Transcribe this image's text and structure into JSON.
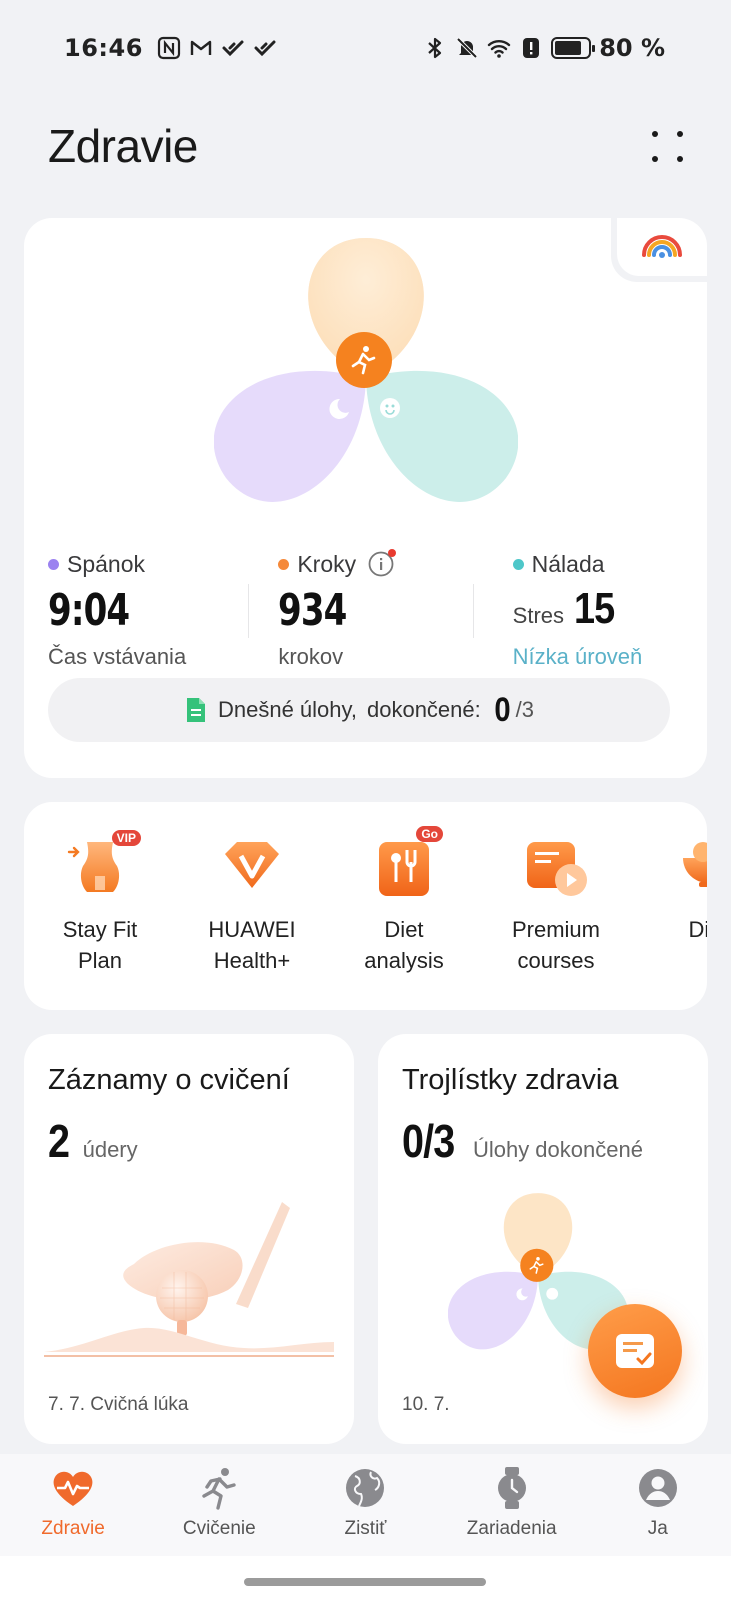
{
  "status_bar": {
    "time": "16:46",
    "battery_text": "80 %",
    "battery_level": 0.8
  },
  "header": {
    "title": "Zdravie"
  },
  "main_card": {
    "metrics": [
      {
        "label": "Spánok",
        "value": "9:04",
        "sub": "Čas vstávania",
        "color": "#9b82f0"
      },
      {
        "label": "Kroky",
        "value": "934",
        "sub": "krokov",
        "color": "#f5893a"
      },
      {
        "label": "Nálada",
        "stress_label": "Stres",
        "value": "15",
        "sub": "Nízka úroveň",
        "color": "#4ec7c9"
      }
    ],
    "tasks": {
      "label": "Dnešné úlohy,",
      "done_label": "dokončené:",
      "count": "0",
      "total": "/3"
    }
  },
  "shortcuts": [
    {
      "label": "Stay Fit\nPlan",
      "icon": "stay-fit-icon",
      "badge": "VIP"
    },
    {
      "label": "HUAWEI\nHealth+",
      "icon": "health-plus-icon"
    },
    {
      "label": "Diet\nanalysis",
      "icon": "diet-analysis-icon",
      "badge": "Go"
    },
    {
      "label": "Premium\ncourses",
      "icon": "premium-courses-icon"
    },
    {
      "label": "Diet",
      "icon": "diet-icon"
    }
  ],
  "exercise_card": {
    "title": "Záznamy o cvičení",
    "value": "2",
    "unit": "údery",
    "footer": "7. 7.  Cvičná lúka"
  },
  "trefoil_card": {
    "title": "Trojlístky zdravia",
    "value": "0/3",
    "unit": "Úlohy dokončené",
    "footer": "10. 7."
  },
  "bottom_nav": [
    {
      "label": "Zdravie",
      "icon": "heart-pulse-icon",
      "active": true
    },
    {
      "label": "Cvičenie",
      "icon": "runner-icon"
    },
    {
      "label": "Zistiť",
      "icon": "globe-icon"
    },
    {
      "label": "Zariadenia",
      "icon": "watch-icon"
    },
    {
      "label": "Ja",
      "icon": "person-icon"
    }
  ],
  "colors": {
    "accent": "#f06a2c",
    "sleep": "#d9ccf7",
    "steps": "#fde5c6",
    "mood": "#c5eeea"
  }
}
